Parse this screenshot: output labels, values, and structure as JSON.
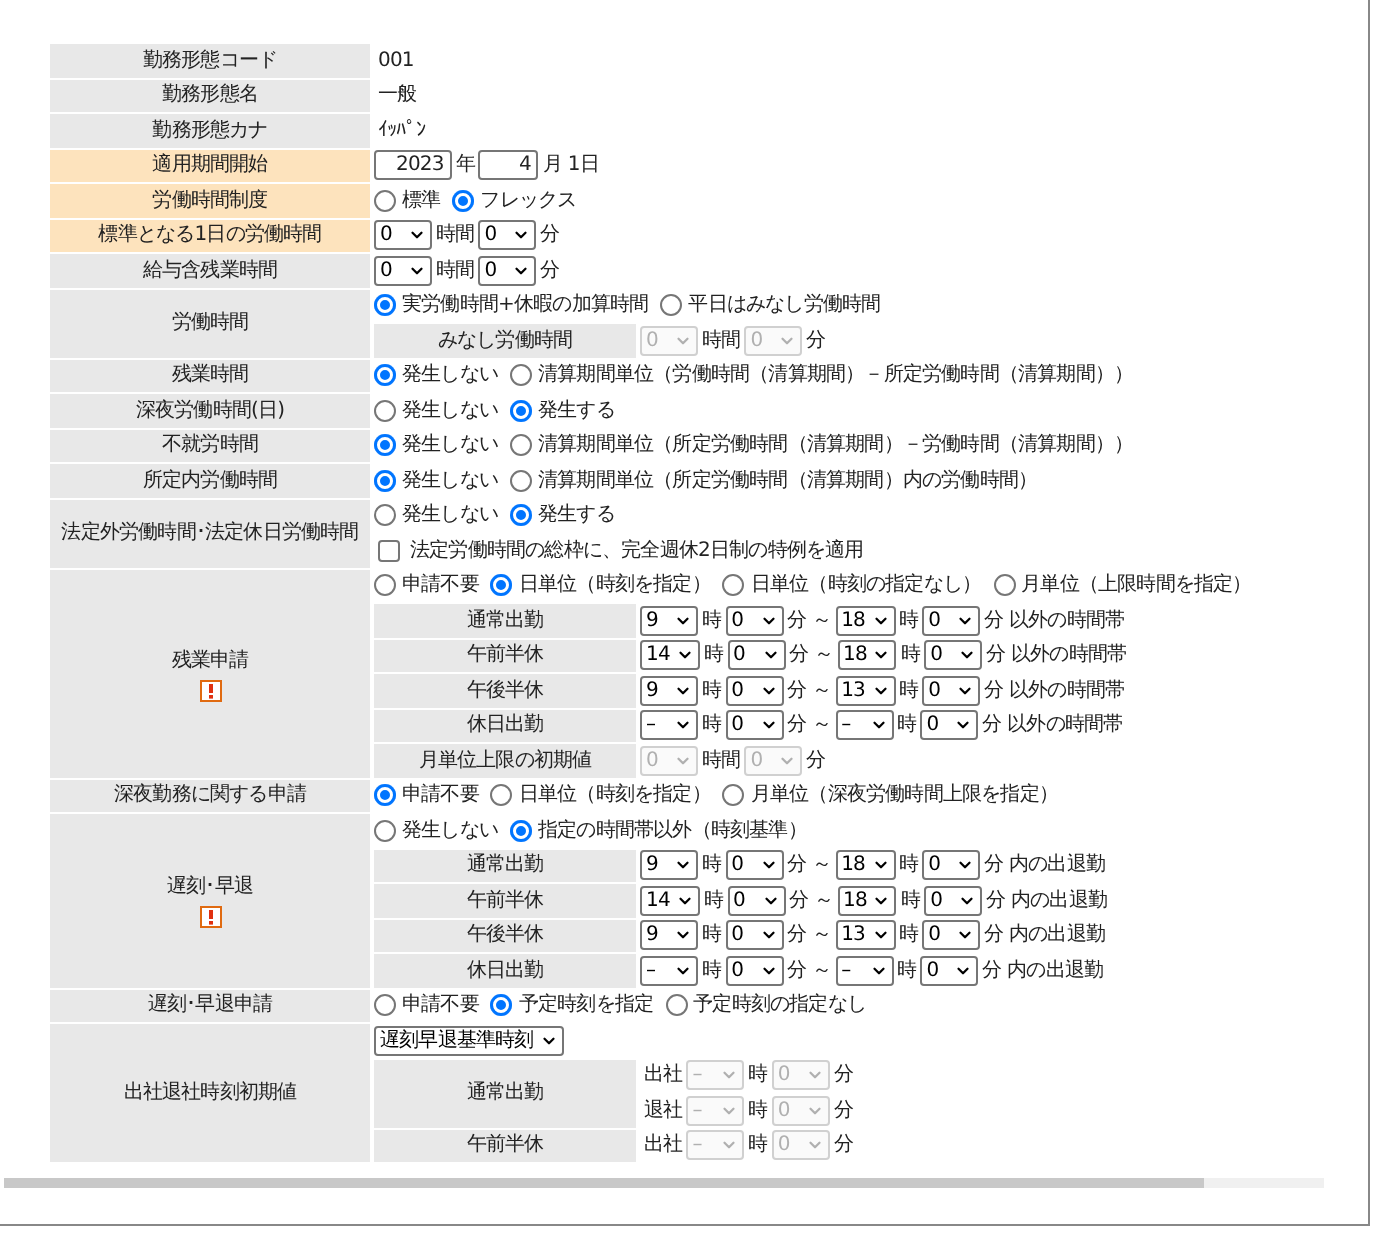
{
  "rows": [
    {
      "label": "勤務形態コード",
      "highlighted": false,
      "warning": false,
      "lines": [
        {
          "kind": "plain",
          "parts": [
            {
              "kind": "text",
              "text": "001"
            }
          ]
        }
      ]
    },
    {
      "label": "勤務形態名",
      "highlighted": false,
      "warning": false,
      "lines": [
        {
          "kind": "plain",
          "parts": [
            {
              "kind": "text",
              "text": "一般"
            }
          ]
        }
      ]
    },
    {
      "label": "勤務形態カナ",
      "highlighted": false,
      "warning": false,
      "lines": [
        {
          "kind": "plain",
          "parts": [
            {
              "kind": "text",
              "text": "ｲｯﾊﾟﾝ"
            }
          ]
        }
      ]
    },
    {
      "label": "適用期間開始",
      "highlighted": true,
      "warning": false,
      "lines": [
        {
          "kind": "plain",
          "parts": [
            {
              "kind": "input",
              "value": "2023"
            },
            {
              "kind": "text",
              "text": "年"
            },
            {
              "kind": "input",
              "value": "4"
            },
            {
              "kind": "text",
              "text": "月 1日"
            }
          ]
        }
      ]
    },
    {
      "label": "労働時間制度",
      "highlighted": true,
      "warning": false,
      "lines": [
        {
          "kind": "plain",
          "parts": [
            {
              "kind": "radio",
              "label": "標準",
              "selected": false
            },
            {
              "kind": "radio",
              "label": "フレックス",
              "selected": true
            }
          ]
        }
      ]
    },
    {
      "label": "標準となる1日の労働時間",
      "highlighted": true,
      "warning": false,
      "lines": [
        {
          "kind": "plain",
          "parts": [
            {
              "kind": "select",
              "value": "0",
              "disabled": false
            },
            {
              "kind": "text",
              "text": "時間"
            },
            {
              "kind": "select",
              "value": "0",
              "disabled": false
            },
            {
              "kind": "text",
              "text": "分"
            }
          ]
        }
      ]
    },
    {
      "label": "給与含残業時間",
      "highlighted": false,
      "warning": false,
      "lines": [
        {
          "kind": "plain",
          "parts": [
            {
              "kind": "select",
              "value": "0",
              "disabled": false
            },
            {
              "kind": "text",
              "text": "時間"
            },
            {
              "kind": "select",
              "value": "0",
              "disabled": false
            },
            {
              "kind": "text",
              "text": "分"
            }
          ]
        }
      ]
    },
    {
      "label": "労働時間",
      "highlighted": false,
      "warning": false,
      "lines": [
        {
          "kind": "plain",
          "parts": [
            {
              "kind": "radio",
              "label": "実労働時間+休暇の加算時間",
              "selected": true
            },
            {
              "kind": "radio",
              "label": "平日はみなし労働時間",
              "selected": false
            }
          ]
        },
        {
          "kind": "sub",
          "label": "みなし労働時間",
          "lines": [
            [
              {
                "kind": "select",
                "value": "0",
                "disabled": true
              },
              {
                "kind": "text",
                "text": "時間"
              },
              {
                "kind": "select",
                "value": "0",
                "disabled": true
              },
              {
                "kind": "text",
                "text": "分"
              }
            ]
          ]
        }
      ]
    },
    {
      "label": "残業時間",
      "highlighted": false,
      "warning": false,
      "lines": [
        {
          "kind": "plain",
          "parts": [
            {
              "kind": "radio",
              "label": "発生しない",
              "selected": true
            },
            {
              "kind": "radio",
              "label": "清算期間単位（労働時間（清算期間）－所定労働時間（清算期間））",
              "selected": false
            }
          ]
        }
      ]
    },
    {
      "label": "深夜労働時間(日)",
      "highlighted": false,
      "warning": false,
      "lines": [
        {
          "kind": "plain",
          "parts": [
            {
              "kind": "radio",
              "label": "発生しない",
              "selected": false
            },
            {
              "kind": "radio",
              "label": "発生する",
              "selected": true
            }
          ]
        }
      ]
    },
    {
      "label": "不就労時間",
      "highlighted": false,
      "warning": false,
      "lines": [
        {
          "kind": "plain",
          "parts": [
            {
              "kind": "radio",
              "label": "発生しない",
              "selected": true
            },
            {
              "kind": "radio",
              "label": "清算期間単位（所定労働時間（清算期間）－労働時間（清算期間））",
              "selected": false
            }
          ]
        }
      ]
    },
    {
      "label": "所定内労働時間",
      "highlighted": false,
      "warning": false,
      "lines": [
        {
          "kind": "plain",
          "parts": [
            {
              "kind": "radio",
              "label": "発生しない",
              "selected": true
            },
            {
              "kind": "radio",
              "label": "清算期間単位（所定労働時間（清算期間）内の労働時間）",
              "selected": false
            }
          ]
        }
      ]
    },
    {
      "label": "法定外労働時間･法定休日労働時間",
      "highlighted": false,
      "warning": false,
      "lines": [
        {
          "kind": "plain",
          "parts": [
            {
              "kind": "radio",
              "label": "発生しない",
              "selected": false
            },
            {
              "kind": "radio",
              "label": "発生する",
              "selected": true
            }
          ]
        },
        {
          "kind": "plain",
          "parts": [
            {
              "kind": "checkbox",
              "label": "法定労働時間の総枠に、完全週休2日制の特例を適用",
              "checked": false
            }
          ]
        }
      ]
    },
    {
      "label": "残業申請",
      "highlighted": false,
      "warning": true,
      "lines": [
        {
          "kind": "plain",
          "parts": [
            {
              "kind": "radio",
              "label": "申請不要",
              "selected": false
            },
            {
              "kind": "radio",
              "label": "日単位（時刻を指定）",
              "selected": true
            },
            {
              "kind": "radio",
              "label": "日単位（時刻の指定なし）",
              "selected": false
            },
            {
              "kind": "radio",
              "label": "月単位（上限時間を指定）",
              "selected": false
            }
          ]
        },
        {
          "kind": "sub",
          "label": "通常出勤",
          "lines": [
            [
              {
                "kind": "select",
                "value": "9",
                "disabled": false
              },
              {
                "kind": "text",
                "text": "時"
              },
              {
                "kind": "select",
                "value": "0",
                "disabled": false
              },
              {
                "kind": "text",
                "text": "分 ～"
              },
              {
                "kind": "select",
                "value": "18",
                "disabled": false
              },
              {
                "kind": "text",
                "text": "時"
              },
              {
                "kind": "select",
                "value": "0",
                "disabled": false
              },
              {
                "kind": "text",
                "text": "分 以外の時間帯"
              }
            ]
          ]
        },
        {
          "kind": "sub",
          "label": "午前半休",
          "lines": [
            [
              {
                "kind": "select",
                "value": "14",
                "disabled": false
              },
              {
                "kind": "text",
                "text": "時"
              },
              {
                "kind": "select",
                "value": "0",
                "disabled": false
              },
              {
                "kind": "text",
                "text": "分 ～"
              },
              {
                "kind": "select",
                "value": "18",
                "disabled": false
              },
              {
                "kind": "text",
                "text": "時"
              },
              {
                "kind": "select",
                "value": "0",
                "disabled": false
              },
              {
                "kind": "text",
                "text": "分 以外の時間帯"
              }
            ]
          ]
        },
        {
          "kind": "sub",
          "label": "午後半休",
          "lines": [
            [
              {
                "kind": "select",
                "value": "9",
                "disabled": false
              },
              {
                "kind": "text",
                "text": "時"
              },
              {
                "kind": "select",
                "value": "0",
                "disabled": false
              },
              {
                "kind": "text",
                "text": "分 ～"
              },
              {
                "kind": "select",
                "value": "13",
                "disabled": false
              },
              {
                "kind": "text",
                "text": "時"
              },
              {
                "kind": "select",
                "value": "0",
                "disabled": false
              },
              {
                "kind": "text",
                "text": "分 以外の時間帯"
              }
            ]
          ]
        },
        {
          "kind": "sub",
          "label": "休日出勤",
          "lines": [
            [
              {
                "kind": "select",
                "value": "–",
                "disabled": false
              },
              {
                "kind": "text",
                "text": "時"
              },
              {
                "kind": "select",
                "value": "0",
                "disabled": false
              },
              {
                "kind": "text",
                "text": "分 ～"
              },
              {
                "kind": "select",
                "value": "–",
                "disabled": false
              },
              {
                "kind": "text",
                "text": "時"
              },
              {
                "kind": "select",
                "value": "0",
                "disabled": false
              },
              {
                "kind": "text",
                "text": "分 以外の時間帯"
              }
            ]
          ]
        },
        {
          "kind": "sub",
          "label": "月単位上限の初期値",
          "lines": [
            [
              {
                "kind": "select",
                "value": "0",
                "disabled": true
              },
              {
                "kind": "text",
                "text": "時間"
              },
              {
                "kind": "select",
                "value": "0",
                "disabled": true
              },
              {
                "kind": "text",
                "text": "分"
              }
            ]
          ]
        }
      ]
    },
    {
      "label": "深夜勤務に関する申請",
      "highlighted": false,
      "warning": false,
      "lines": [
        {
          "kind": "plain",
          "parts": [
            {
              "kind": "radio",
              "label": "申請不要",
              "selected": true
            },
            {
              "kind": "radio",
              "label": "日単位（時刻を指定）",
              "selected": false
            },
            {
              "kind": "radio",
              "label": "月単位（深夜労働時間上限を指定）",
              "selected": false
            }
          ]
        }
      ]
    },
    {
      "label": "遅刻･早退",
      "highlighted": false,
      "warning": true,
      "lines": [
        {
          "kind": "plain",
          "parts": [
            {
              "kind": "radio",
              "label": "発生しない",
              "selected": false
            },
            {
              "kind": "radio",
              "label": "指定の時間帯以外（時刻基準）",
              "selected": true
            }
          ]
        },
        {
          "kind": "sub",
          "label": "通常出勤",
          "lines": [
            [
              {
                "kind": "select",
                "value": "9",
                "disabled": false
              },
              {
                "kind": "text",
                "text": "時"
              },
              {
                "kind": "select",
                "value": "0",
                "disabled": false
              },
              {
                "kind": "text",
                "text": "分 ～"
              },
              {
                "kind": "select",
                "value": "18",
                "disabled": false
              },
              {
                "kind": "text",
                "text": "時"
              },
              {
                "kind": "select",
                "value": "0",
                "disabled": false
              },
              {
                "kind": "text",
                "text": "分 内の出退勤"
              }
            ]
          ]
        },
        {
          "kind": "sub",
          "label": "午前半休",
          "lines": [
            [
              {
                "kind": "select",
                "value": "14",
                "disabled": false
              },
              {
                "kind": "text",
                "text": "時"
              },
              {
                "kind": "select",
                "value": "0",
                "disabled": false
              },
              {
                "kind": "text",
                "text": "分 ～"
              },
              {
                "kind": "select",
                "value": "18",
                "disabled": false
              },
              {
                "kind": "text",
                "text": "時"
              },
              {
                "kind": "select",
                "value": "0",
                "disabled": false
              },
              {
                "kind": "text",
                "text": "分 内の出退勤"
              }
            ]
          ]
        },
        {
          "kind": "sub",
          "label": "午後半休",
          "lines": [
            [
              {
                "kind": "select",
                "value": "9",
                "disabled": false
              },
              {
                "kind": "text",
                "text": "時"
              },
              {
                "kind": "select",
                "value": "0",
                "disabled": false
              },
              {
                "kind": "text",
                "text": "分 ～"
              },
              {
                "kind": "select",
                "value": "13",
                "disabled": false
              },
              {
                "kind": "text",
                "text": "時"
              },
              {
                "kind": "select",
                "value": "0",
                "disabled": false
              },
              {
                "kind": "text",
                "text": "分 内の出退勤"
              }
            ]
          ]
        },
        {
          "kind": "sub",
          "label": "休日出勤",
          "lines": [
            [
              {
                "kind": "select",
                "value": "–",
                "disabled": false
              },
              {
                "kind": "text",
                "text": "時"
              },
              {
                "kind": "select",
                "value": "0",
                "disabled": false
              },
              {
                "kind": "text",
                "text": "分 ～"
              },
              {
                "kind": "select",
                "value": "–",
                "disabled": false
              },
              {
                "kind": "text",
                "text": "時"
              },
              {
                "kind": "select",
                "value": "0",
                "disabled": false
              },
              {
                "kind": "text",
                "text": "分 内の出退勤"
              }
            ]
          ]
        }
      ]
    },
    {
      "label": "遅刻･早退申請",
      "highlighted": false,
      "warning": false,
      "lines": [
        {
          "kind": "plain",
          "parts": [
            {
              "kind": "radio",
              "label": "申請不要",
              "selected": false
            },
            {
              "kind": "radio",
              "label": "予定時刻を指定",
              "selected": true
            },
            {
              "kind": "radio",
              "label": "予定時刻の指定なし",
              "selected": false
            }
          ]
        }
      ]
    },
    {
      "label": "出社退社時刻初期値",
      "highlighted": false,
      "warning": false,
      "lines": [
        {
          "kind": "plain",
          "parts": [
            {
              "kind": "select",
              "value": "遅刻早退基準時刻",
              "disabled": false
            }
          ]
        },
        {
          "kind": "sub",
          "label": "通常出勤",
          "lines": [
            [
              {
                "kind": "text",
                "text": "出社"
              },
              {
                "kind": "select",
                "value": "–",
                "disabled": true
              },
              {
                "kind": "text",
                "text": "時"
              },
              {
                "kind": "select",
                "value": "0",
                "disabled": true
              },
              {
                "kind": "text",
                "text": "分"
              }
            ],
            [
              {
                "kind": "text",
                "text": "退社"
              },
              {
                "kind": "select",
                "value": "–",
                "disabled": true
              },
              {
                "kind": "text",
                "text": "時"
              },
              {
                "kind": "select",
                "value": "0",
                "disabled": true
              },
              {
                "kind": "text",
                "text": "分"
              }
            ]
          ]
        },
        {
          "kind": "sub",
          "label": "午前半休",
          "lines": [
            [
              {
                "kind": "text",
                "text": "出社"
              },
              {
                "kind": "select",
                "value": "–",
                "disabled": true
              },
              {
                "kind": "text",
                "text": "時"
              },
              {
                "kind": "select",
                "value": "0",
                "disabled": true
              },
              {
                "kind": "text",
                "text": "分"
              }
            ]
          ]
        }
      ]
    }
  ]
}
